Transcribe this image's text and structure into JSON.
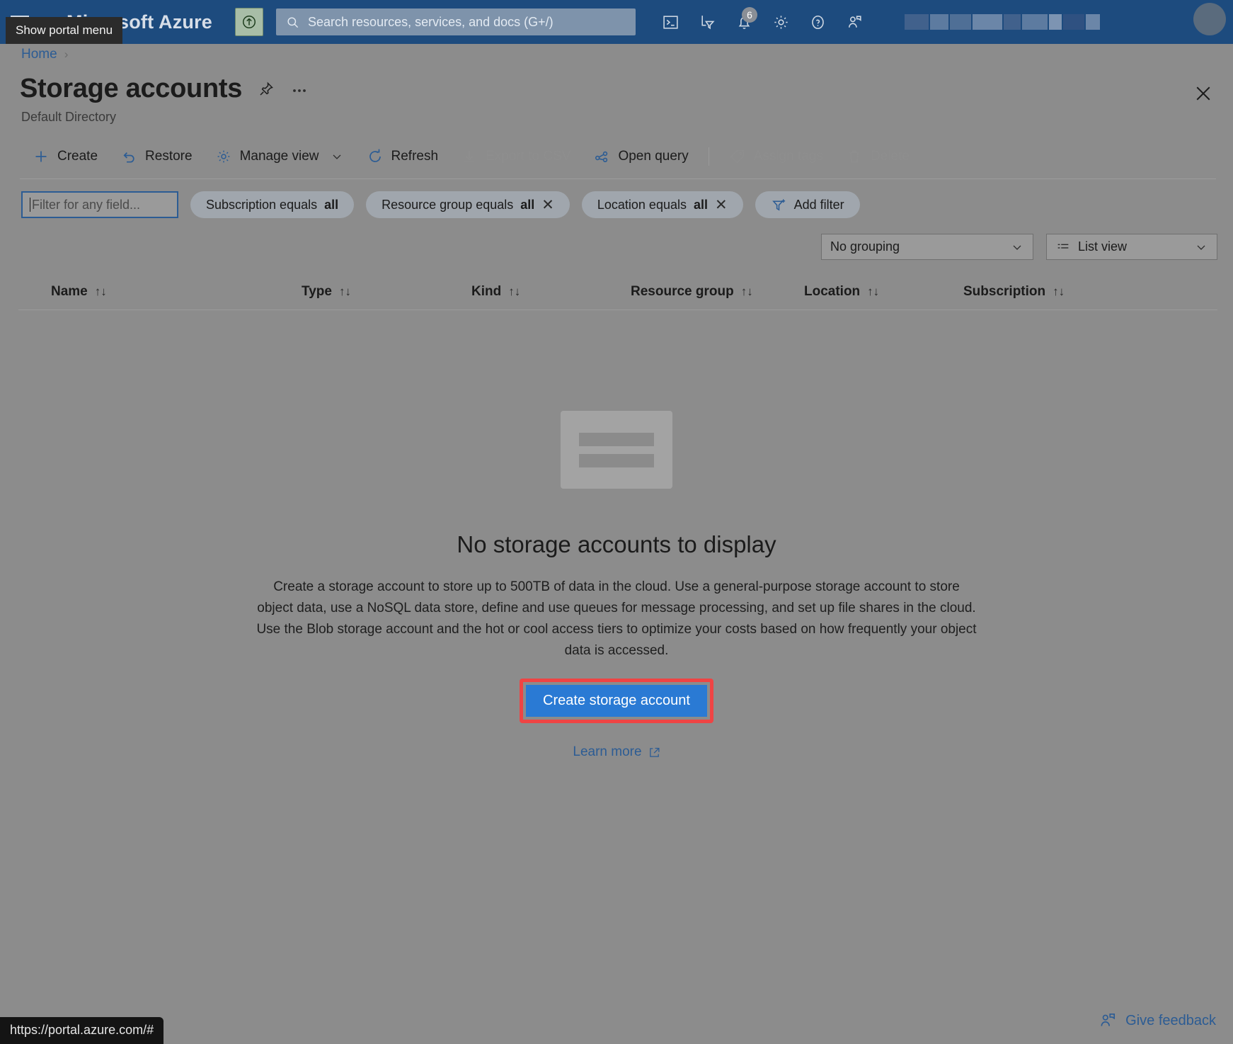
{
  "topbar": {
    "menu_tooltip": "Show portal menu",
    "brand": "Microsoft Azure",
    "search_placeholder": "Search resources, services, and docs (G+/)",
    "icons": [
      {
        "name": "cloud-shell-icon",
        "label": "Cloud Shell"
      },
      {
        "name": "directories-subscriptions-icon",
        "label": "Directories + subscriptions"
      },
      {
        "name": "notifications-bell-icon",
        "label": "Notifications",
        "badge": "6"
      },
      {
        "name": "settings-gear-icon",
        "label": "Settings"
      },
      {
        "name": "help-question-icon",
        "label": "Help"
      },
      {
        "name": "feedback-person-icon",
        "label": "Feedback"
      }
    ]
  },
  "breadcrumb": {
    "home": "Home",
    "separator": "›"
  },
  "header": {
    "title": "Storage accounts",
    "subtitle": "Default Directory",
    "pin_title": "Pin to dashboard",
    "more_title": "More",
    "close_title": "Close"
  },
  "toolbar": [
    {
      "name": "create-button",
      "label": "Create",
      "icon": "plus-icon",
      "disabled": false
    },
    {
      "name": "restore-button",
      "label": "Restore",
      "icon": "undo-arrow-icon",
      "disabled": false
    },
    {
      "name": "manage-view-button",
      "label": "Manage view",
      "icon": "gear-icon",
      "disabled": false,
      "chevron": true
    },
    {
      "name": "refresh-button",
      "label": "Refresh",
      "icon": "refresh-icon",
      "disabled": false
    },
    {
      "name": "export-to-csv-button",
      "label": "Export to CSV",
      "icon": "download-icon",
      "disabled": true
    },
    {
      "name": "open-query-button",
      "label": "Open query",
      "icon": "query-icon",
      "disabled": false
    },
    {
      "name": "assign-tags-button",
      "label": "Assign tags",
      "icon": "tag-icon",
      "disabled": true
    },
    {
      "name": "delete-button",
      "label": "Delete",
      "icon": "trash-icon",
      "disabled": true
    }
  ],
  "filters": {
    "search_placeholder": "Filter for any field...",
    "search_value": "",
    "pills": [
      {
        "name": "filter-pill-subscription",
        "prefix": "Subscription equals ",
        "value": "all",
        "removable": false
      },
      {
        "name": "filter-pill-resource-group",
        "prefix": "Resource group equals ",
        "value": "all",
        "removable": true
      },
      {
        "name": "filter-pill-location",
        "prefix": "Location equals ",
        "value": "all",
        "removable": true
      }
    ],
    "add_filter_label": "Add filter"
  },
  "view_controls": {
    "grouping_value": "No grouping",
    "view_value": "List view"
  },
  "table": {
    "columns": [
      {
        "name": "column-header-name",
        "label": "Name"
      },
      {
        "name": "column-header-type",
        "label": "Type"
      },
      {
        "name": "column-header-kind",
        "label": "Kind"
      },
      {
        "name": "column-header-resource-group",
        "label": "Resource group"
      },
      {
        "name": "column-header-location",
        "label": "Location"
      },
      {
        "name": "column-header-subscription",
        "label": "Subscription"
      }
    ],
    "rows": []
  },
  "empty_state": {
    "title": "No storage accounts to display",
    "body": "Create a storage account to store up to 500TB of data in the cloud. Use a general-purpose storage account to store object data, use a NoSQL data store, define and use queues for message processing, and set up file shares in the cloud. Use the Blob storage account and the hot or cool access tiers to optimize your costs based on how frequently your object data is accessed.",
    "cta_label": "Create storage account",
    "learn_more_label": "Learn more",
    "highlight_color": "#ef4444",
    "cta_color": "#2a7ad4"
  },
  "footer": {
    "feedback_label": "Give feedback",
    "status_url": "https://portal.azure.com/#"
  }
}
